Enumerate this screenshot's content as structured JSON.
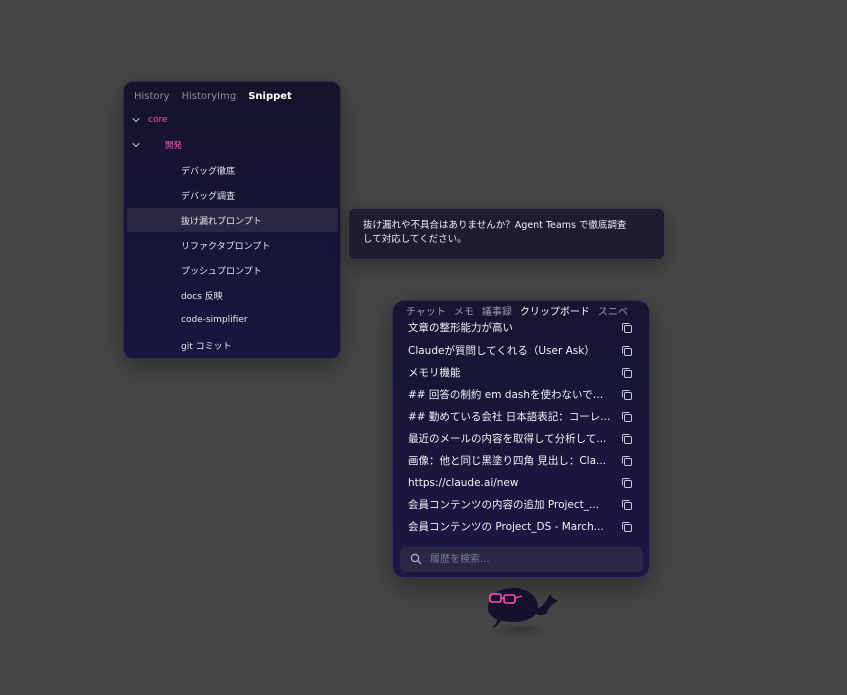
{
  "snippet_panel": {
    "tabs": [
      {
        "label": "History",
        "active": false
      },
      {
        "label": "HistoryImg",
        "active": false
      },
      {
        "label": "Snippet",
        "active": true
      }
    ],
    "tree": [
      {
        "label": "core",
        "type": "folder",
        "expanded": true
      },
      {
        "label": "開発",
        "type": "folder",
        "expanded": true
      },
      {
        "label": "デバッグ徹底",
        "type": "item"
      },
      {
        "label": "デバッグ調査",
        "type": "item"
      },
      {
        "label": "抜け漏れプロンプト",
        "type": "item",
        "selected": true
      },
      {
        "label": "リファクタプロンプト",
        "type": "item"
      },
      {
        "label": "プッシュプロンプト",
        "type": "item"
      },
      {
        "label": "docs 反映",
        "type": "item"
      },
      {
        "label": "code-simplifier",
        "type": "item"
      },
      {
        "label": "git コミット",
        "type": "item"
      }
    ]
  },
  "tooltip": {
    "line1": "抜け漏れや不具合はありませんか？Agent Teams で徹底調査",
    "line2": "して対応してください。"
  },
  "clipboard_panel": {
    "tabs": [
      {
        "label": "チャット",
        "active": false
      },
      {
        "label": "メモ",
        "active": false
      },
      {
        "label": "議事録",
        "active": false
      },
      {
        "label": "クリップボード",
        "active": true
      },
      {
        "label": "スニペ",
        "active": false
      }
    ],
    "items": [
      "文章の整形能力が高い",
      "Claudeが質問してくれる（User Ask）",
      "メモリ機能",
      "## 回答の制約 em dashを使わないでく...",
      "## 勤めている会社 日本語表記：コーレ...",
      "最近のメールの内容を取得して分析して...",
      "画像：他と同じ黒塗り四角 見出し：Cla...",
      "https://claude.ai/new",
      "会員コンテンツの内容の追加 Project_...",
      "会員コンテンツの Project_DS - March..."
    ],
    "search": {
      "placeholder": "履歴を検索...",
      "value": ""
    }
  },
  "colors": {
    "accent_pink": "#ff4fb2",
    "background": "#464646",
    "panel_dark": "#16142e"
  },
  "icons": {
    "chevron": "chevron-down-icon",
    "copy": "copy-icon",
    "search": "search-icon",
    "mascot": "whale-mascot-icon"
  }
}
